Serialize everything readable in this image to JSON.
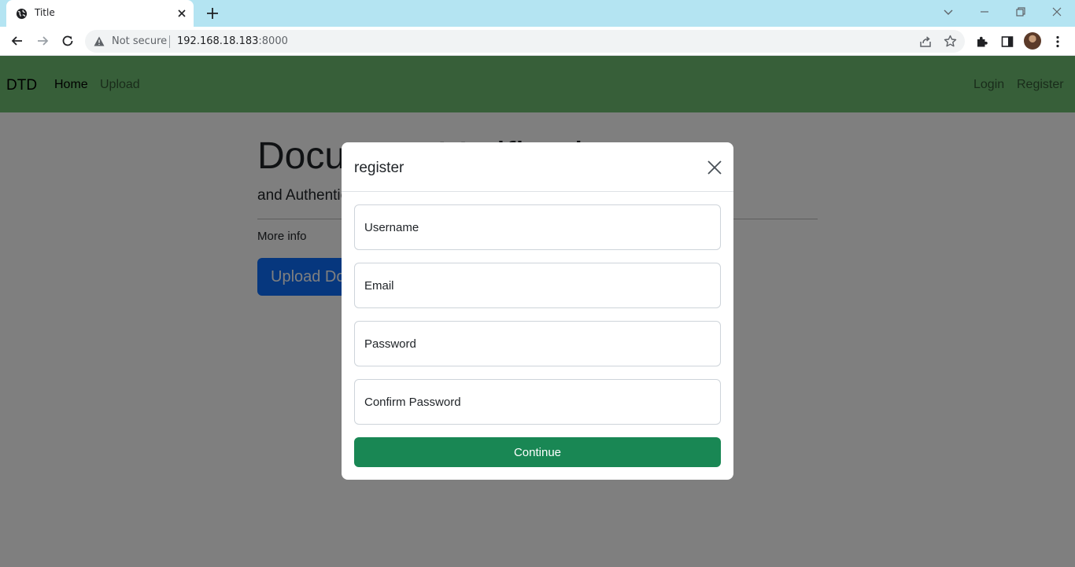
{
  "browser": {
    "tab_title": "Title",
    "security_label": "Not secure",
    "url_host": "192.168.18.183",
    "url_port": ":8000"
  },
  "icons": {
    "favicon": "globe-icon",
    "tab_close": "close-icon",
    "new_tab": "plus-icon",
    "tab_search": "chevron-down-icon",
    "minimize": "minimize-icon",
    "maximize": "restore-icon",
    "window_close": "close-icon",
    "back": "arrow-left-icon",
    "forward": "arrow-right-icon",
    "reload": "reload-icon",
    "security": "warning-icon",
    "share": "share-icon",
    "bookmark": "star-icon",
    "extensions": "puzzle-icon",
    "side_panel": "side-panel-icon",
    "profile": "avatar",
    "menu": "kebab-menu-icon"
  },
  "navbar": {
    "brand": "DTD",
    "links": [
      {
        "label": "Home"
      },
      {
        "label": "Upload"
      }
    ],
    "right_links": [
      {
        "label": "Login"
      },
      {
        "label": "Register"
      }
    ],
    "background": "#6fbf73"
  },
  "hero": {
    "title": "Document Verification",
    "lead": "and Authentication",
    "more_info": "More info",
    "button_label": "Upload Document"
  },
  "modal": {
    "title": "register",
    "fields": [
      {
        "placeholder": "Username"
      },
      {
        "placeholder": "Email"
      },
      {
        "placeholder": "Password"
      },
      {
        "placeholder": "Confirm Password"
      }
    ],
    "submit_label": "Continue",
    "submit_color": "#198754"
  }
}
